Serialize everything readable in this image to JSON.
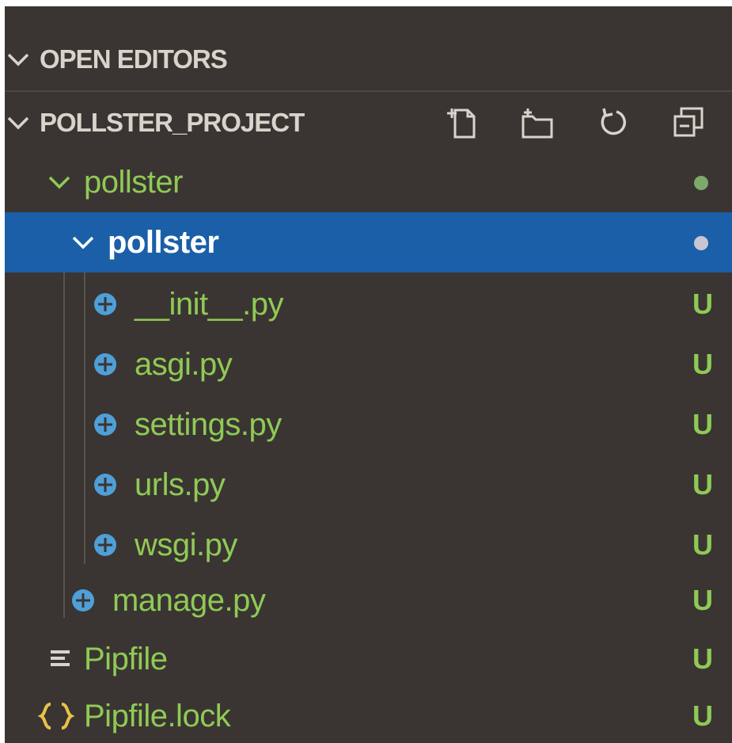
{
  "colors": {
    "panel_background": "#3a3532",
    "selection": "#1a5fa8",
    "untracked_text": "#8fca55",
    "header_text": "#d8d4cc",
    "python_icon": "#4f9fd8"
  },
  "open_editors": {
    "label": "OPEN EDITORS",
    "chevron": "chevron-down-icon"
  },
  "project": {
    "label": "POLLSTER_PROJECT",
    "chevron": "chevron-down-icon",
    "toolbar": [
      "new-file-icon",
      "new-folder-icon",
      "refresh-icon",
      "collapse-all-icon"
    ]
  },
  "tree": [
    {
      "label": "pollster",
      "kind": "folder",
      "icon": "chevron-down-icon",
      "status": "dot",
      "selected": false
    },
    {
      "label": "pollster",
      "kind": "folder",
      "icon": "chevron-down-icon",
      "status": "dot",
      "selected": true
    },
    {
      "label": "__init__.py",
      "kind": "file",
      "icon": "python-icon",
      "status": "U"
    },
    {
      "label": "asgi.py",
      "kind": "file",
      "icon": "python-icon",
      "status": "U"
    },
    {
      "label": "settings.py",
      "kind": "file",
      "icon": "python-icon",
      "status": "U"
    },
    {
      "label": "urls.py",
      "kind": "file",
      "icon": "python-icon",
      "status": "U"
    },
    {
      "label": "wsgi.py",
      "kind": "file",
      "icon": "python-icon",
      "status": "U"
    },
    {
      "label": "manage.py",
      "kind": "file",
      "icon": "python-icon",
      "status": "U"
    },
    {
      "label": "Pipfile",
      "kind": "file",
      "icon": "text-lines-icon",
      "status": "U"
    },
    {
      "label": "Pipfile.lock",
      "kind": "file",
      "icon": "json-braces-icon",
      "status": "U"
    }
  ]
}
